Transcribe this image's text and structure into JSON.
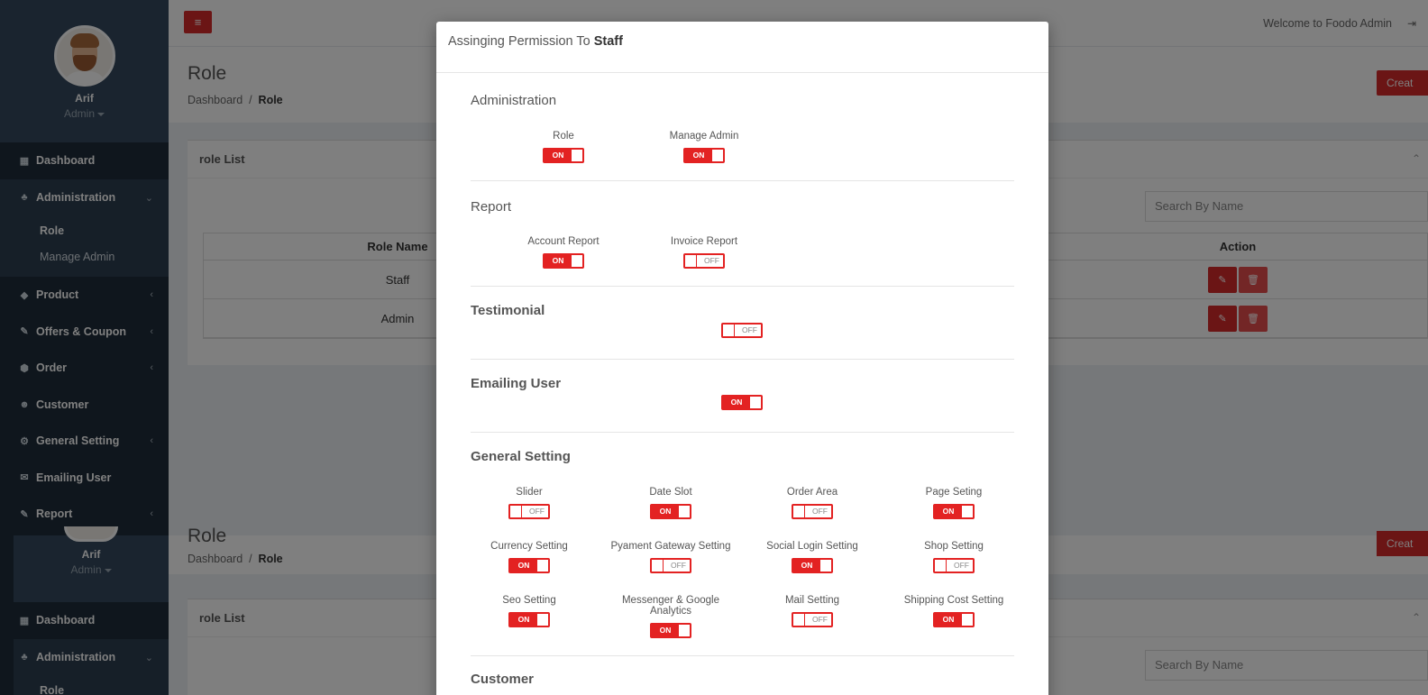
{
  "app": {
    "welcome": "Welcome to Foodo Admin",
    "accent_color": "#d62b2b"
  },
  "user": {
    "name": "Arif",
    "role": "Admin"
  },
  "sidebar": {
    "items": [
      {
        "label": "Dashboard",
        "icon": "dashboard-icon",
        "glyph": "▦"
      },
      {
        "label": "Administration",
        "icon": "sitemap-icon",
        "glyph": "♣"
      },
      {
        "label": "Product",
        "icon": "diamond-icon",
        "glyph": "◆"
      },
      {
        "label": "Offers & Coupon",
        "icon": "pencil-icon",
        "glyph": "✎"
      },
      {
        "label": "Order",
        "icon": "cube-icon",
        "glyph": "⬢"
      },
      {
        "label": "Customer",
        "icon": "users-icon",
        "glyph": "☻"
      },
      {
        "label": "General Setting",
        "icon": "gear-icon",
        "glyph": "⚙"
      },
      {
        "label": "Emailing User",
        "icon": "envelope-icon",
        "glyph": "✉"
      },
      {
        "label": "Report",
        "icon": "pencil-icon",
        "glyph": "✎"
      }
    ],
    "submenu": [
      "Role",
      "Manage Admin"
    ]
  },
  "page": {
    "title": "Role",
    "breadcrumb_root": "Dashboard",
    "breadcrumb_sep": "/",
    "breadcrumb_current": "Role",
    "create_label": "Creat"
  },
  "card": {
    "title": "role List",
    "search_placeholder": "Search By Name",
    "columns": {
      "name": "Role Name",
      "action": "Action"
    },
    "rows": [
      "Staff",
      "Admin"
    ]
  },
  "modal": {
    "title_prefix": "Assinging Permission To",
    "title_role": "Staff",
    "on_label": "ON",
    "off_label": "OFF",
    "sections": [
      {
        "title": "Administration",
        "perms": [
          {
            "label": "Role",
            "on": true
          },
          {
            "label": "Manage Admin",
            "on": true
          }
        ]
      },
      {
        "title": "Report",
        "perms": [
          {
            "label": "Account Report",
            "on": true
          },
          {
            "label": "Invoice Report",
            "on": false
          }
        ]
      },
      {
        "title": "Testimonial",
        "perms": [
          {
            "label": "",
            "on": false
          }
        ]
      },
      {
        "title": "Emailing User",
        "perms": [
          {
            "label": "",
            "on": true
          }
        ]
      },
      {
        "title": "General Setting",
        "perms": [
          {
            "label": "Slider",
            "on": false
          },
          {
            "label": "Date Slot",
            "on": true
          },
          {
            "label": "Order Area",
            "on": false
          },
          {
            "label": "Page Seting",
            "on": true
          },
          {
            "label": "Currency Setting",
            "on": true
          },
          {
            "label": "Pyament Gateway Setting",
            "on": false
          },
          {
            "label": "Social Login Setting",
            "on": true
          },
          {
            "label": "Shop Setting",
            "on": false
          },
          {
            "label": "Seo Setting",
            "on": true
          },
          {
            "label": "Messenger & Google Analytics",
            "on": true
          },
          {
            "label": "Mail Setting",
            "on": false
          },
          {
            "label": "Shipping Cost Setting",
            "on": true
          }
        ]
      },
      {
        "title": "Customer",
        "perms": []
      }
    ]
  }
}
